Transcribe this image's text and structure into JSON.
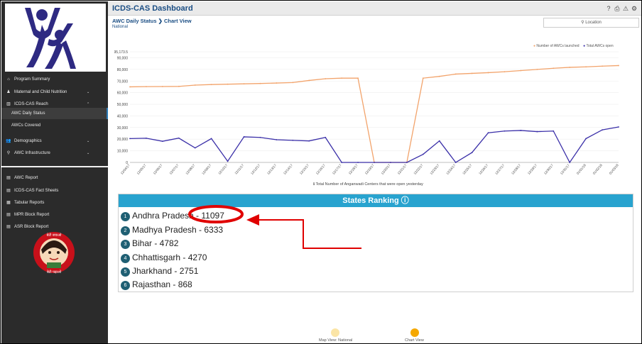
{
  "header": {
    "title": "ICDS-CAS Dashboard",
    "icons": [
      "help-icon",
      "print-icon",
      "warning-icon",
      "gear-icon"
    ]
  },
  "breadcrumb": {
    "section": "AWC Daily Status",
    "separator": "❯",
    "view": "Chart View",
    "scope": "National"
  },
  "location_button": {
    "label": "Location"
  },
  "sidebar": {
    "items": [
      {
        "label": "Program Summary",
        "icon": "home-icon",
        "chevron": false
      },
      {
        "label": "Maternal and Child Nutrition",
        "icon": "child-icon",
        "chevron": true
      },
      {
        "label": "ICDS-CAS Reach",
        "icon": "bar-chart-icon",
        "chevron": true
      },
      {
        "label": "AWC Daily Status",
        "sub": true,
        "active": true
      },
      {
        "label": "AWCs Covered",
        "sub": true
      },
      {
        "label": "Demographics",
        "icon": "users-icon",
        "chevron": true
      },
      {
        "label": "AWC Infrastructure",
        "icon": "map-pin-icon",
        "chevron": true
      },
      {
        "label": "AWC Report",
        "icon": "report-icon"
      },
      {
        "label": "ICDS-CAS Fact Sheets",
        "icon": "sheet-icon"
      },
      {
        "label": "Tabular Reports",
        "icon": "table-icon"
      },
      {
        "label": "MPR Block Report",
        "icon": "report-icon"
      },
      {
        "label": "ASR Block Report",
        "icon": "report-icon"
      }
    ],
    "badge": {
      "top": "बेटी बचाओ",
      "bottom": "बेटी पढ़ाओ"
    }
  },
  "chart_data": {
    "type": "line",
    "x": [
      "12/04/17",
      "12/05/17",
      "12/06/17",
      "12/07/17",
      "12/08/17",
      "12/09/17",
      "12/10/17",
      "12/11/17",
      "12/12/17",
      "12/13/17",
      "12/14/17",
      "12/15/17",
      "12/16/17",
      "12/17/17",
      "12/18/17",
      "12/19/17",
      "12/20/17",
      "12/21/17",
      "12/22/17",
      "12/23/17",
      "12/24/17",
      "12/25/17",
      "12/26/17",
      "12/27/17",
      "12/28/17",
      "12/29/17",
      "12/30/17",
      "12/31/17",
      "01/01/18",
      "01/02/18",
      "01/03/18"
    ],
    "series": [
      {
        "name": "Number of AWCs launched",
        "color": "#f2a36b",
        "values": [
          65000,
          65200,
          65300,
          65400,
          66500,
          67000,
          67300,
          67600,
          67900,
          68300,
          68700,
          70500,
          72000,
          72500,
          72500,
          0,
          0,
          0,
          72500,
          74000,
          76000,
          76600,
          77200,
          78000,
          79000,
          80000,
          81000,
          81800,
          82200,
          82800,
          83300
        ]
      },
      {
        "name": "Total AWCs open",
        "color": "#3a2fa8",
        "values": [
          20500,
          20800,
          18200,
          20900,
          12500,
          20500,
          1000,
          22000,
          21500,
          19500,
          19000,
          18500,
          21500,
          0,
          0,
          0,
          0,
          0,
          7000,
          18500,
          0,
          8500,
          25500,
          27000,
          27500,
          26500,
          27000,
          0,
          20500,
          28000,
          30500
        ]
      }
    ],
    "ylim": [
      0,
      95173.5
    ],
    "yticks": [
      "0",
      "10,000",
      "20,000",
      "30,000",
      "40,000",
      "50,000",
      "60,000",
      "70,000",
      "80,000",
      "90,000",
      "95,173.5"
    ],
    "caption": "Total Number of Anganwadi Centers that were open yesterday",
    "legend_position": "top-right",
    "grid": true
  },
  "ranking": {
    "title": "States Ranking",
    "rows": [
      {
        "rank": "1",
        "label": "Andhra Pradesh - 11097"
      },
      {
        "rank": "2",
        "label": "Madhya Pradesh - 6333"
      },
      {
        "rank": "3",
        "label": "Bihar - 4782"
      },
      {
        "rank": "4",
        "label": "Chhattisgarh - 4270"
      },
      {
        "rank": "5",
        "label": "Jharkhand - 2751"
      },
      {
        "rank": "6",
        "label": "Rajasthan - 868"
      }
    ]
  },
  "footer": {
    "map_view": "Map View: National",
    "chart_view": "Chart View",
    "map_color": "#fbe5a6",
    "chart_color": "#f5a800"
  },
  "colors": {
    "accent": "#1b4e84",
    "ranking_header": "#28a3cf",
    "annotation": "#e00000"
  }
}
